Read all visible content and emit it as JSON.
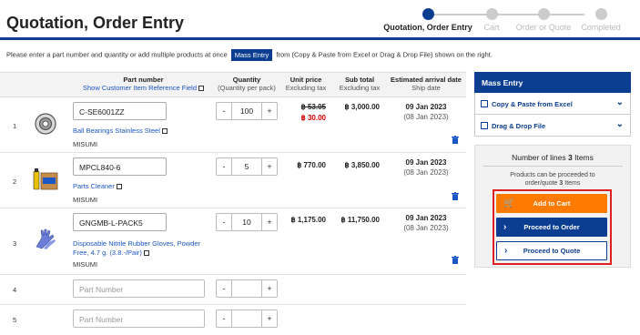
{
  "page_title": "Quotation, Order Entry",
  "steps": [
    {
      "label": "Quotation, Order Entry",
      "active": true
    },
    {
      "label": "Cart",
      "active": false
    },
    {
      "label": "Order or Quote",
      "active": false
    },
    {
      "label": "Completed",
      "active": false
    }
  ],
  "instructions": {
    "before": "Please enter a part number and quantity or add multiple products at once",
    "button": "Mass Entry",
    "after": "from (Copy & Paste from Excel or Drag & Drop File) shown on the right."
  },
  "table": {
    "headers": {
      "part_number": "Part number",
      "show_ref": "Show Customer Item Reference Field",
      "quantity": "Quantity",
      "quantity_sub": "(Quantity per pack)",
      "unit_price": "Unit price",
      "unit_price_sub": "Excluding tax",
      "sub_total": "Sub total",
      "sub_total_sub": "Excluding tax",
      "arrival": "Estimated arrival date",
      "arrival_sub": "Ship date"
    },
    "rows": [
      {
        "num": "1",
        "part_number": "C-SE6001ZZ",
        "name": "Ball Bearings Stainless Steel",
        "brand": "MISUMI",
        "qty": "100",
        "price_old": "฿ 53.05",
        "price": "฿ 30.00",
        "subtotal": "฿ 3,000.00",
        "arrival": "09 Jan 2023",
        "ship": "(08 Jan 2023)"
      },
      {
        "num": "2",
        "part_number": "MPCL840-6",
        "name": "Parts Cleaner",
        "brand": "MISUMI",
        "qty": "5",
        "price": "฿ 770.00",
        "subtotal": "฿ 3,850.00",
        "arrival": "09 Jan 2023",
        "ship": "(08 Jan 2023)"
      },
      {
        "num": "3",
        "part_number": "GNGMB-L-PACK5",
        "name": "Disposable Nitrile Rubber Gloves, Powder Free, 4.7 g. (3.8.-/Pair)",
        "brand": "MISUMI",
        "qty": "10",
        "price": "฿ 1,175.00",
        "subtotal": "฿ 11,750.00",
        "arrival": "09 Jan 2023",
        "ship": "(08 Jan 2023)"
      },
      {
        "num": "4",
        "placeholder": "Part Number"
      },
      {
        "num": "5",
        "placeholder": "Part Number"
      }
    ]
  },
  "mass_entry": {
    "title": "Mass Entry",
    "items": [
      "Copy & Paste from Excel",
      "Drag & Drop File"
    ]
  },
  "summary": {
    "lines_label": "Number of lines",
    "lines_count": "3",
    "lines_unit": "Items",
    "msg_line1": "Products can be proceeded to",
    "msg_line2_before": "order/quote",
    "msg_count": "3",
    "msg_line2_after": "Items"
  },
  "buttons": {
    "add_to_cart": "Add to Cart",
    "proceed_order": "Proceed to Order",
    "proceed_quote": "Proceed to Quote"
  },
  "colors": {
    "brand_blue": "#0b3d91",
    "cart_orange": "#ff7a00",
    "discount_red": "#d40000",
    "highlight_red": "#e02020"
  }
}
